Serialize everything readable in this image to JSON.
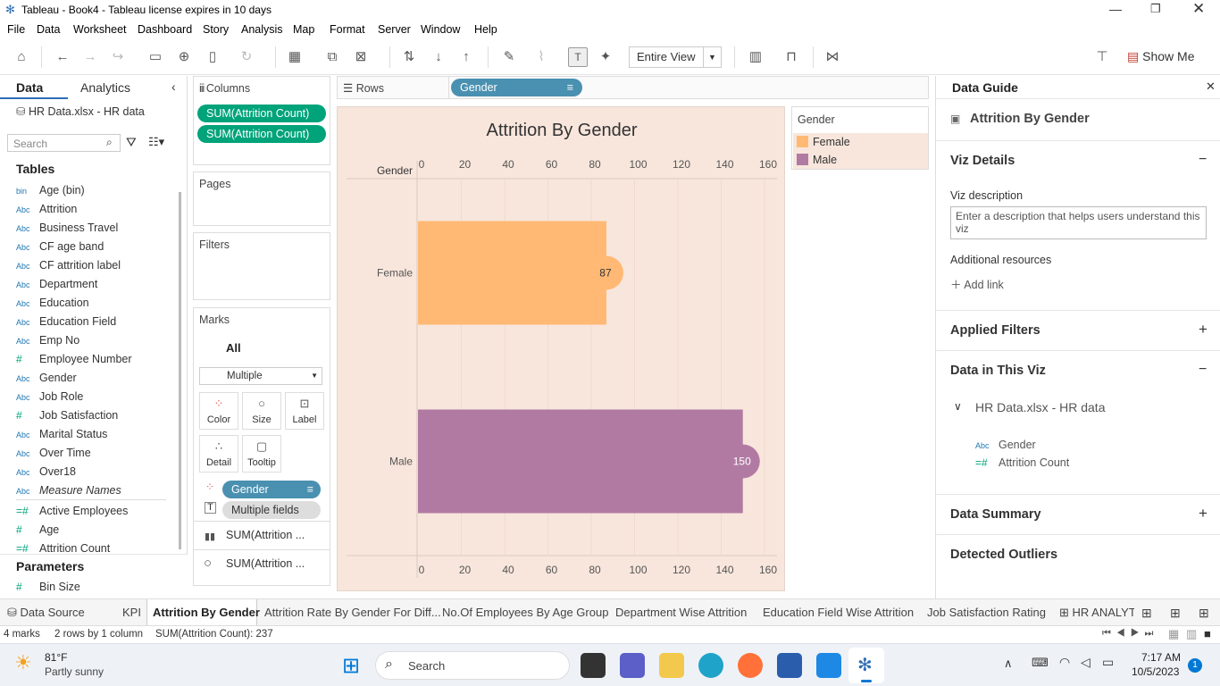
{
  "window": {
    "title": "Tableau - Book4 - Tableau license expires in 10 days"
  },
  "menu": [
    "File",
    "Data",
    "Worksheet",
    "Dashboard",
    "Story",
    "Analysis",
    "Map",
    "Format",
    "Server",
    "Window",
    "Help"
  ],
  "toolbar": {
    "fit_value": "Entire View",
    "show_me": "Show Me"
  },
  "data_pane": {
    "tab_data": "Data",
    "tab_analytics": "Analytics",
    "source": "HR Data.xlsx - HR data",
    "search_placeholder": "Search",
    "tables_heading": "Tables",
    "fields": [
      {
        "icon": "bin",
        "name": "Age (bin)"
      },
      {
        "icon": "Abc",
        "name": "Attrition"
      },
      {
        "icon": "Abc",
        "name": "Business Travel"
      },
      {
        "icon": "Abc",
        "name": "CF age band"
      },
      {
        "icon": "Abc",
        "name": "CF attrition label"
      },
      {
        "icon": "Abc",
        "name": "Department"
      },
      {
        "icon": "Abc",
        "name": "Education"
      },
      {
        "icon": "Abc",
        "name": "Education Field"
      },
      {
        "icon": "Abc",
        "name": "Emp No"
      },
      {
        "icon": "#",
        "name": "Employee Number"
      },
      {
        "icon": "Abc",
        "name": "Gender"
      },
      {
        "icon": "Abc",
        "name": "Job Role"
      },
      {
        "icon": "#",
        "name": "Job Satisfaction"
      },
      {
        "icon": "Abc",
        "name": "Marital Status"
      },
      {
        "icon": "Abc",
        "name": "Over Time"
      },
      {
        "icon": "Abc",
        "name": "Over18"
      },
      {
        "icon": "Abc",
        "name": "Measure Names"
      },
      {
        "icon": "=#",
        "name": "Active Employees"
      },
      {
        "icon": "#",
        "name": "Age"
      },
      {
        "icon": "=#",
        "name": "Attrition Count"
      }
    ],
    "parameters_heading": "Parameters",
    "parameter": {
      "icon": "#",
      "name": "Bin Size"
    }
  },
  "shelves": {
    "columns_label": "Columns",
    "columns_pills": [
      "SUM(Attrition Count)",
      "SUM(Attrition Count)"
    ],
    "rows_label": "Rows",
    "rows_pill": "Gender",
    "pages_label": "Pages",
    "filters_label": "Filters",
    "marks_label": "Marks",
    "marks_all": "All",
    "mark_type": "Multiple",
    "mark_cards": [
      "Color",
      "Size",
      "Label",
      "Detail",
      "Tooltip"
    ],
    "mark_pills": [
      "Gender",
      "Multiple fields"
    ],
    "mark_sections": [
      "SUM(Attrition ...",
      "SUM(Attrition ..."
    ]
  },
  "chart_data": {
    "type": "bar",
    "title": "Attrition By Gender",
    "row_header": "Gender",
    "categories": [
      "Female",
      "Male"
    ],
    "values": [
      87,
      150
    ],
    "value_labels": [
      "87",
      "150"
    ],
    "xlim": [
      0,
      160
    ],
    "xticks": [
      "0",
      "20",
      "40",
      "60",
      "80",
      "100",
      "120",
      "140",
      "160"
    ],
    "colors": [
      "#ffb974",
      "#b17aa3"
    ],
    "background": "#f8e6dc",
    "legend_placement": "right"
  },
  "legend": {
    "title": "Gender",
    "items": [
      {
        "label": "Female",
        "color": "#ffb974"
      },
      {
        "label": "Male",
        "color": "#b17aa3"
      }
    ]
  },
  "guide": {
    "title": "Data Guide",
    "viz_title": "Attrition By Gender",
    "viz_details": "Viz Details",
    "viz_description_label": "Viz description",
    "viz_description_placeholder": "Enter a description that helps users understand this viz",
    "additional_resources": "Additional resources",
    "add_link": "Add link",
    "applied_filters": "Applied Filters",
    "data_in_viz": "Data in This Viz",
    "source": "HR Data.xlsx - HR data",
    "fields": [
      {
        "icon": "Abc",
        "name": "Gender"
      },
      {
        "icon": "=#",
        "name": "Attrition Count"
      }
    ],
    "data_summary": "Data Summary",
    "detected_outliers": "Detected Outliers"
  },
  "sheet_tabs": [
    "Data Source",
    "KPI",
    "Attrition By Gender",
    "Attrition Rate By Gender For Diff...",
    "No.Of Employees By Age Group",
    "Department Wise Attrition",
    "Education Field Wise Attrition",
    "Job Satisfaction Rating",
    "HR ANALYT"
  ],
  "status": {
    "marks": "4 marks",
    "rows": "2 rows by 1 column",
    "sum": "SUM(Attrition Count): 237"
  },
  "taskbar": {
    "weather_temp": "81°F",
    "weather_desc": "Partly sunny",
    "search": "Search",
    "time": "7:17 AM",
    "date": "10/5/2023",
    "badge": "1"
  }
}
